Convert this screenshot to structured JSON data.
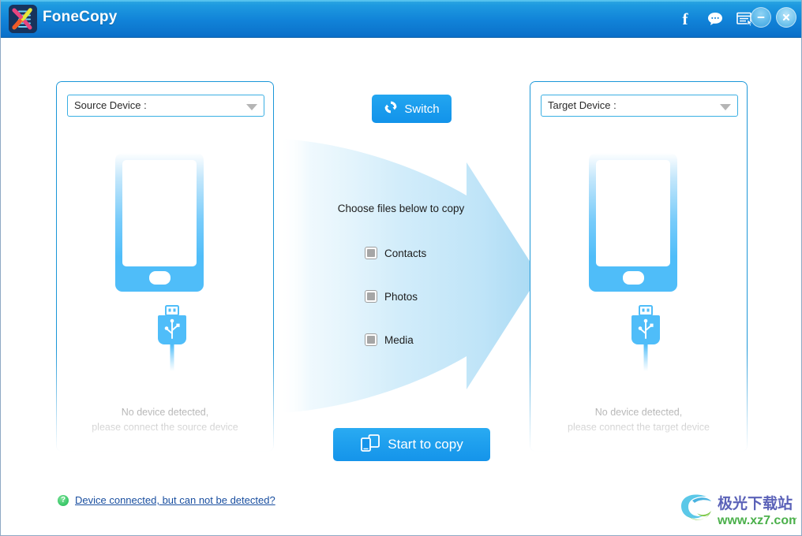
{
  "window": {
    "app_title": "FoneCopy",
    "logo_icon": "fonecopy-dna-logo"
  },
  "titlebar": {
    "icons": [
      {
        "name": "facebook-icon",
        "glyph": "f"
      },
      {
        "name": "feedback-chat-icon",
        "glyph": "speech-bubble"
      },
      {
        "name": "register-form-icon",
        "glyph": "form-with-cursor"
      }
    ],
    "minimize_label": "minimize-icon",
    "close_label": "close-icon"
  },
  "source_panel": {
    "select_label": "Source Device :",
    "select_caret": "chevron-down-icon",
    "phone_icon": "phone-outline-icon",
    "usb_icon": "usb-connector-icon",
    "status_line1": "No device detected,",
    "status_line2": "please connect the source device"
  },
  "target_panel": {
    "select_label": "Target Device :",
    "select_caret": "chevron-down-icon",
    "phone_icon": "phone-outline-icon",
    "usb_icon": "usb-connector-icon",
    "status_line1": "No device detected,",
    "status_line2": "please connect the target device"
  },
  "center": {
    "switch_label": "Switch",
    "switch_icon": "refresh-sync-icon",
    "choose_text": "Choose files below to copy",
    "file_types": [
      {
        "label": "Contacts",
        "checked": false,
        "enabled": false
      },
      {
        "label": "Photos",
        "checked": false,
        "enabled": false
      },
      {
        "label": "Media",
        "checked": false,
        "enabled": false
      }
    ],
    "start_label": "Start to copy",
    "start_icon": "two-devices-icon",
    "arrow_icon": "right-arrow-shape"
  },
  "footer": {
    "help_icon": "question-mark-icon",
    "help_text": "Device connected, but can not be detected?"
  },
  "watermark": {
    "logo_icon": "xz7-swirl-logo",
    "site_name": "极光下载站",
    "site_url": "www.xz7.com"
  },
  "colors": {
    "titlebar_top": "#2fa9e2",
    "titlebar_bottom": "#0a6fc9",
    "accent_blue": "#1a9ced",
    "panel_border": "#1a96d8",
    "link_blue": "#1a4fa0",
    "help_green": "#27b457",
    "arrow_fill": "#bfe3f8"
  }
}
